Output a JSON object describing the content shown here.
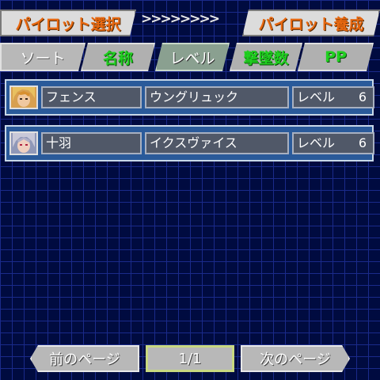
{
  "header": {
    "tab_left": "パイロット選択",
    "arrows": ">>>>>>>>",
    "tab_right": "パイロット養成"
  },
  "sort_bar": {
    "label": "ソート",
    "options": [
      "名称",
      "レベル",
      "撃墜数",
      "PP"
    ],
    "active": "レベル"
  },
  "pilots": [
    {
      "name": "フェンス",
      "unit": "ウングリュック",
      "level_label": "レベル",
      "level": "6",
      "portrait": "blonde-pilot-portrait"
    },
    {
      "name": "十羽",
      "unit": "イクスヴァイス",
      "level_label": "レベル",
      "level": "6",
      "portrait": "silver-haired-pilot-portrait"
    }
  ],
  "pager": {
    "prev_label": "前のページ",
    "page": "1/1",
    "next_label": "次のページ"
  }
}
